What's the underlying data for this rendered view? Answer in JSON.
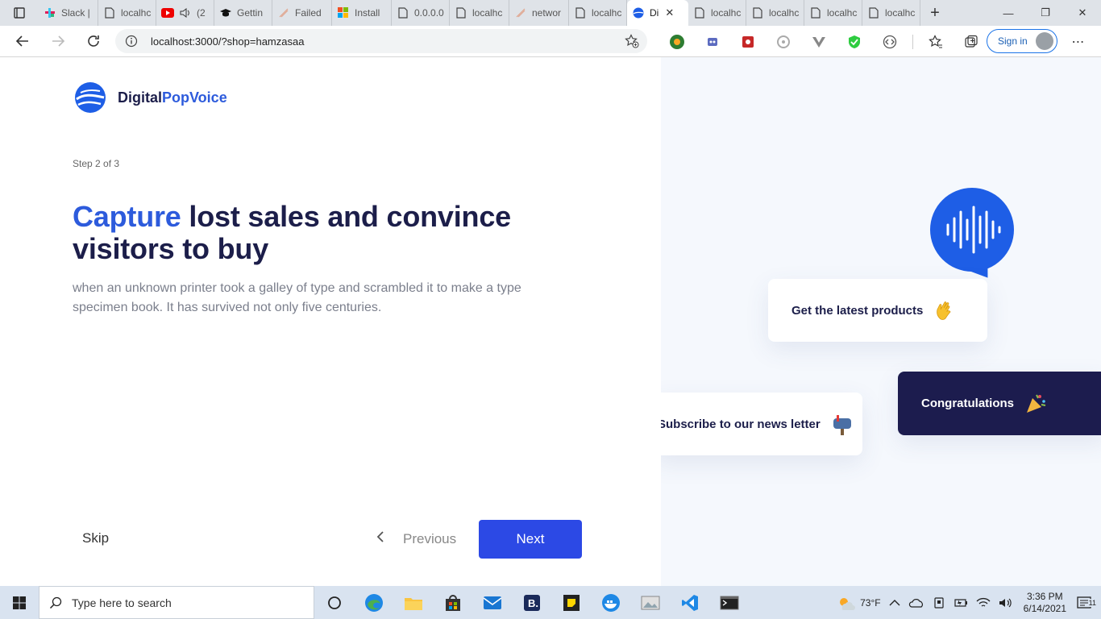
{
  "browser": {
    "tabs": [
      {
        "label": "Slack |",
        "icon": "slack-icon"
      },
      {
        "label": "localhc",
        "icon": "page-icon"
      },
      {
        "label": "(2",
        "icon": "youtube-icon"
      },
      {
        "label": "Gettin",
        "icon": "graduation-cap-icon"
      },
      {
        "label": "Failed",
        "icon": "git-icon"
      },
      {
        "label": "Install",
        "icon": "microsoft-icon"
      },
      {
        "label": "0.0.0.0",
        "icon": "page-icon"
      },
      {
        "label": "localhc",
        "icon": "page-icon"
      },
      {
        "label": "networ",
        "icon": "git-icon"
      },
      {
        "label": "localhc",
        "icon": "page-icon"
      },
      {
        "label": "Di",
        "icon": "digitalpopvoice-icon",
        "active": true
      },
      {
        "label": "localhc",
        "icon": "page-icon"
      },
      {
        "label": "localhc",
        "icon": "page-icon"
      },
      {
        "label": "localhc",
        "icon": "page-icon"
      },
      {
        "label": "localhc",
        "icon": "page-icon"
      }
    ],
    "address": "localhost:3000/?shop=hamzasaa",
    "signin_label": "Sign in"
  },
  "page": {
    "logo": {
      "part1": "Digital",
      "part2": "PopVoice"
    },
    "step": "Step 2 of 3",
    "headline": {
      "accent": "Capture",
      "rest": " lost sales and convince visitors to buy"
    },
    "description": "when an unknown printer took a galley of type and scrambled it to make a type specimen book. It has survived not only five centuries.",
    "buttons": {
      "skip": "Skip",
      "previous": "Previous",
      "next": "Next"
    },
    "illustration": {
      "card_latest": "Get the latest products",
      "card_news": "Subscribe to our news letter",
      "card_congrats": "Congratulations"
    },
    "colors": {
      "accent": "#2d5bdc",
      "dark": "#1c1e4a",
      "next_button": "#2c49e5"
    }
  },
  "taskbar": {
    "search_placeholder": "Type here to search",
    "weather": "73°F",
    "time": "3:36 PM",
    "date": "6/14/2021",
    "notifications": "11"
  }
}
